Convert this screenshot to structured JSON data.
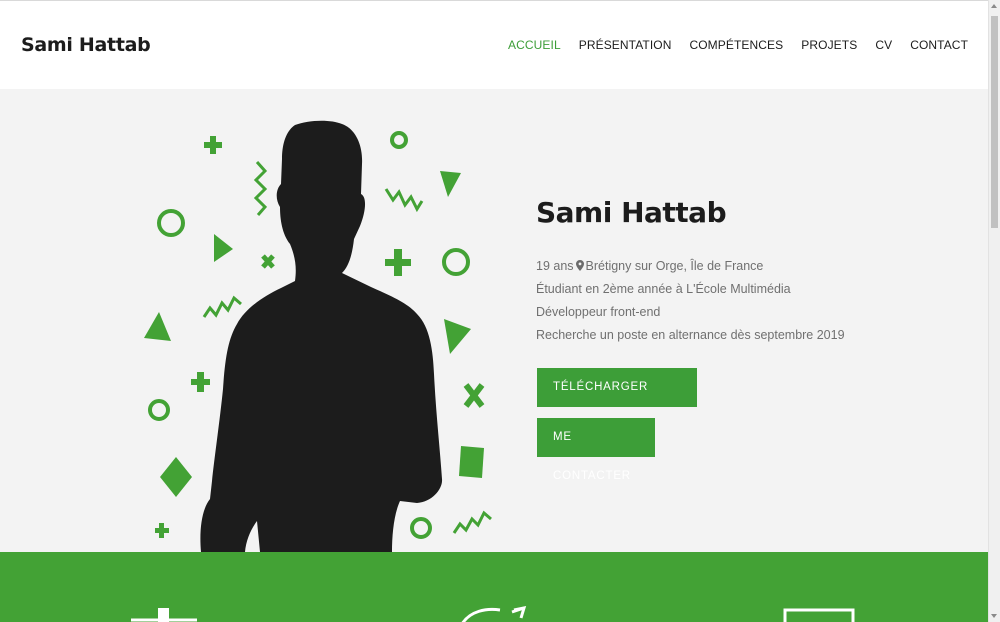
{
  "brand": {
    "name": "Sami Hattab"
  },
  "nav": {
    "items": [
      {
        "label": "ACCUEIL",
        "active": true
      },
      {
        "label": "PRÉSENTATION",
        "active": false
      },
      {
        "label": "COMPÉTENCES",
        "active": false
      },
      {
        "label": "PROJETS",
        "active": false
      },
      {
        "label": "CV",
        "active": false
      },
      {
        "label": "CONTACT",
        "active": false
      }
    ]
  },
  "hero": {
    "title": "Sami Hattab",
    "age": "19 ans",
    "location": "Brétigny sur Orge, Île de France",
    "line2": "Étudiant en 2ème année à L'École Multimédia",
    "line3": "Développeur front-end",
    "line4": "Recherche un poste en alternance dès septembre 2019",
    "cv_button": "TÉLÉCHARGER MON CV",
    "contact_button": "ME CONTACTER"
  },
  "colors": {
    "accent": "#3d9e38",
    "band": "#43a235",
    "hero_bg": "#f3f3f3",
    "text": "#1c1c1c"
  },
  "icons": [
    "location-pin-icon",
    "silhouette",
    "decorative-shapes"
  ]
}
